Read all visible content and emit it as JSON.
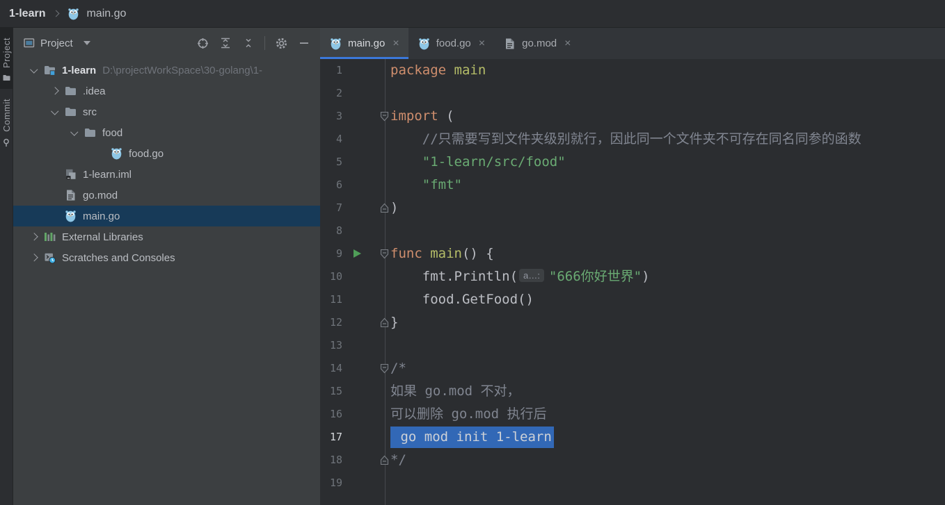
{
  "colors": {
    "panel_bg": "#3C3F41",
    "editor_bg": "#2B2D30",
    "topbar_bg": "#2C2E31",
    "accent_blue": "#3B78D9",
    "tree_selection": "#173A58",
    "editor_selection": "#3268B6",
    "keyword": "#CF8E6D",
    "string": "#6AAB73",
    "comment": "#808590",
    "declaration": "#B5BD68",
    "run_green": "#4F9E58"
  },
  "breadcrumb": {
    "project": "1-learn",
    "file": "main.go"
  },
  "stripe": {
    "tabs": [
      {
        "label": "Project",
        "icon": "stripe-project",
        "active": true
      },
      {
        "label": "Commit",
        "icon": "stripe-commit",
        "active": false
      }
    ]
  },
  "project_panel": {
    "title": "Project",
    "toolbar": [
      {
        "name": "locate",
        "icon": "locate"
      },
      {
        "name": "expand-all",
        "icon": "expand"
      },
      {
        "name": "collapse-all",
        "icon": "collapse"
      },
      {
        "name": "separator",
        "icon": "sep"
      },
      {
        "name": "settings",
        "icon": "gear"
      },
      {
        "name": "hide",
        "icon": "minus"
      }
    ],
    "tree": [
      {
        "label": "1-learn",
        "path": "D:\\projectWorkSpace\\30-golang\\1-",
        "icon": "module",
        "chev": "down",
        "pad": 16,
        "bold": true,
        "selected": false
      },
      {
        "label": ".idea",
        "path": "",
        "icon": "folder",
        "chev": "right",
        "pad": 46,
        "bold": false,
        "selected": false
      },
      {
        "label": "src",
        "path": "",
        "icon": "folder",
        "chev": "down",
        "pad": 46,
        "bold": false,
        "selected": false
      },
      {
        "label": "food",
        "path": "",
        "icon": "folder",
        "chev": "down",
        "pad": 74,
        "bold": false,
        "selected": false
      },
      {
        "label": "food.go",
        "path": "",
        "icon": "go",
        "chev": "none",
        "pad": 112,
        "bold": false,
        "selected": false
      },
      {
        "label": "1-learn.iml",
        "path": "",
        "icon": "iml",
        "chev": "none",
        "pad": 46,
        "bold": false,
        "selected": false
      },
      {
        "label": "go.mod",
        "path": "",
        "icon": "mod",
        "chev": "none",
        "pad": 46,
        "bold": false,
        "selected": false
      },
      {
        "label": "main.go",
        "path": "",
        "icon": "go",
        "chev": "none",
        "pad": 46,
        "bold": false,
        "selected": true
      },
      {
        "label": "External Libraries",
        "path": "",
        "icon": "libs",
        "chev": "right",
        "pad": 16,
        "bold": false,
        "selected": false
      },
      {
        "label": "Scratches and Consoles",
        "path": "",
        "icon": "scratch",
        "chev": "right",
        "pad": 16,
        "bold": false,
        "selected": false
      }
    ]
  },
  "editor": {
    "close_glyph": "×",
    "tabs": [
      {
        "label": "main.go",
        "icon": "go",
        "active": true
      },
      {
        "label": "food.go",
        "icon": "go",
        "active": false
      },
      {
        "label": "go.mod",
        "icon": "mod",
        "active": false
      }
    ],
    "lines": [
      {
        "n": "1",
        "fold": "",
        "run": false,
        "current": false,
        "tokens": [
          [
            "k",
            "package"
          ],
          [
            "t",
            " "
          ],
          [
            "f",
            "main"
          ]
        ]
      },
      {
        "n": "2",
        "fold": "",
        "run": false,
        "current": false,
        "tokens": []
      },
      {
        "n": "3",
        "fold": "start",
        "run": false,
        "current": false,
        "tokens": [
          [
            "k",
            "import"
          ],
          [
            "t",
            " ("
          ]
        ]
      },
      {
        "n": "4",
        "fold": "",
        "run": false,
        "current": false,
        "tokens": [
          [
            "t",
            "    "
          ],
          [
            "c",
            "//只需要写到文件夹级别就行，因此同一个文件夹不可存在同名同参的函数"
          ]
        ]
      },
      {
        "n": "5",
        "fold": "",
        "run": false,
        "current": false,
        "tokens": [
          [
            "t",
            "    "
          ],
          [
            "s",
            "\"1-learn/src/food\""
          ]
        ]
      },
      {
        "n": "6",
        "fold": "",
        "run": false,
        "current": false,
        "tokens": [
          [
            "t",
            "    "
          ],
          [
            "s",
            "\"fmt\""
          ]
        ]
      },
      {
        "n": "7",
        "fold": "end",
        "run": false,
        "current": false,
        "tokens": [
          [
            "t",
            ")"
          ]
        ]
      },
      {
        "n": "8",
        "fold": "",
        "run": false,
        "current": false,
        "tokens": []
      },
      {
        "n": "9",
        "fold": "start",
        "run": true,
        "current": false,
        "tokens": [
          [
            "k",
            "func"
          ],
          [
            "t",
            " "
          ],
          [
            "f",
            "main"
          ],
          [
            "t",
            "() {"
          ]
        ]
      },
      {
        "n": "10",
        "fold": "",
        "run": false,
        "current": false,
        "tokens": [
          [
            "t",
            "    fmt.Println("
          ],
          [
            "i",
            "a…:"
          ],
          [
            "s",
            "\"666你好世界\""
          ],
          [
            "t",
            ")"
          ]
        ]
      },
      {
        "n": "11",
        "fold": "",
        "run": false,
        "current": false,
        "tokens": [
          [
            "t",
            "    food.GetFood()"
          ]
        ]
      },
      {
        "n": "12",
        "fold": "end",
        "run": false,
        "current": false,
        "tokens": [
          [
            "t",
            "}"
          ]
        ]
      },
      {
        "n": "13",
        "fold": "",
        "run": false,
        "current": false,
        "tokens": []
      },
      {
        "n": "14",
        "fold": "start",
        "run": false,
        "current": false,
        "tokens": [
          [
            "c",
            "/*"
          ]
        ]
      },
      {
        "n": "15",
        "fold": "",
        "run": false,
        "current": false,
        "tokens": [
          [
            "c",
            "如果 go.mod 不对，"
          ]
        ]
      },
      {
        "n": "16",
        "fold": "",
        "run": false,
        "current": false,
        "tokens": [
          [
            "c",
            "可以删除 go.mod 执行后"
          ]
        ]
      },
      {
        "n": "17",
        "fold": "",
        "run": false,
        "current": true,
        "tokens": [
          [
            "sel",
            " go mod init 1-learn"
          ]
        ]
      },
      {
        "n": "18",
        "fold": "end",
        "run": false,
        "current": false,
        "tokens": [
          [
            "c",
            "*/"
          ]
        ]
      },
      {
        "n": "19",
        "fold": "",
        "run": false,
        "current": false,
        "tokens": []
      }
    ]
  }
}
